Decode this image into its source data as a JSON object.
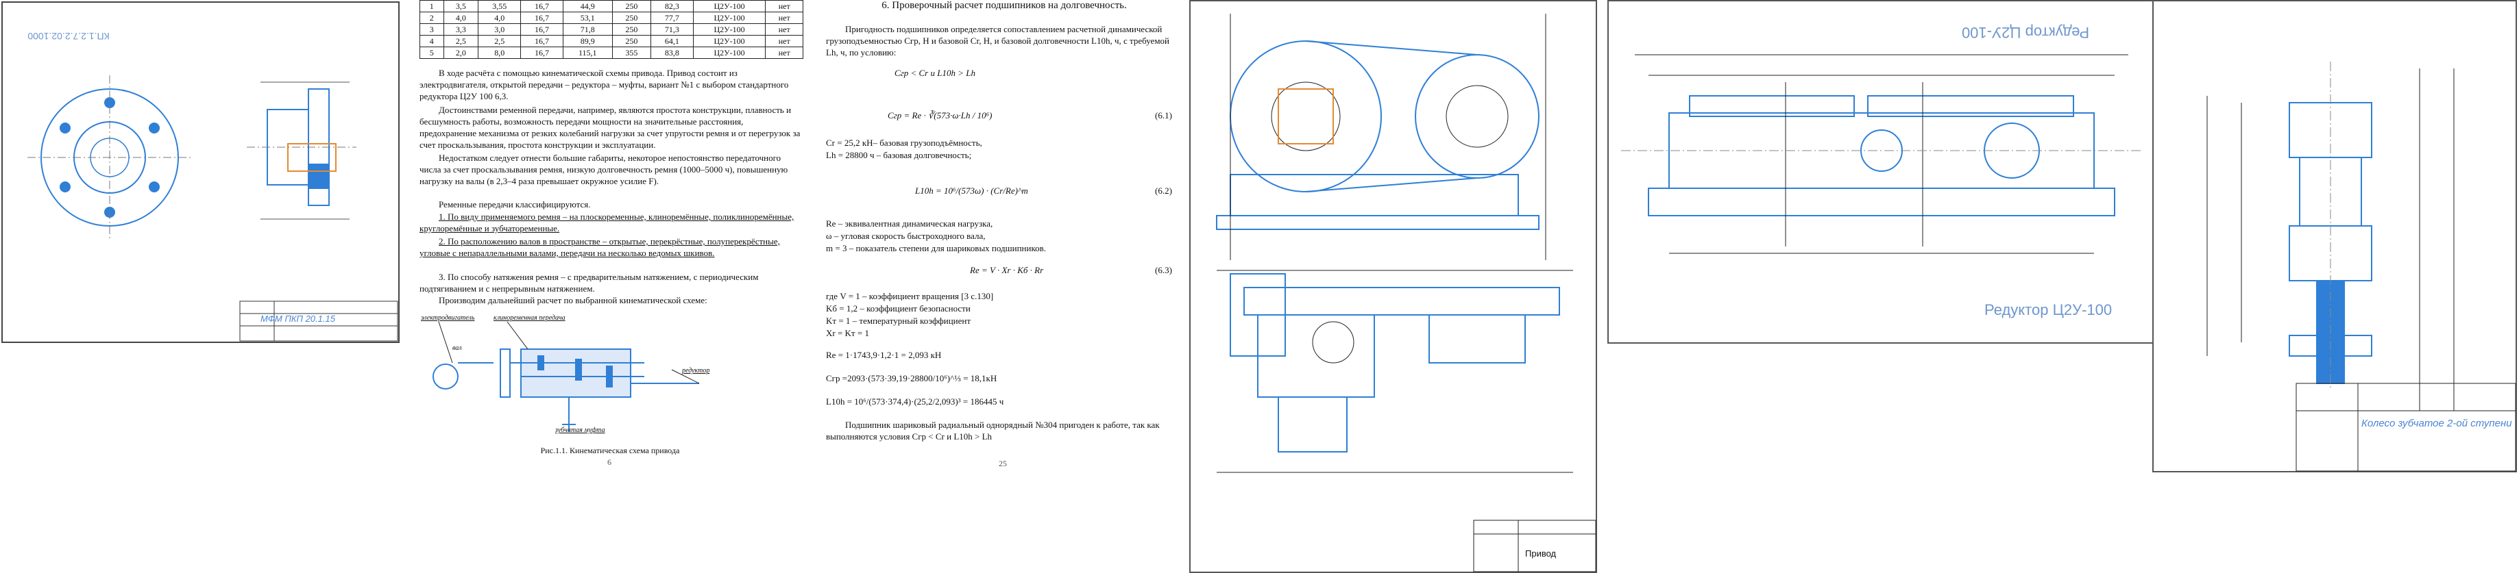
{
  "sheet1": {
    "corner_code": "КП.1.2.7.2.02.1000",
    "stamp": "МФМ ПКП 20.1.15"
  },
  "doc1": {
    "table": {
      "rows": [
        [
          "1",
          "3,5",
          "3,55",
          "16,7",
          "44,9",
          "250",
          "82,3",
          "Ц2У-100",
          "нет"
        ],
        [
          "2",
          "4,0",
          "4,0",
          "16,7",
          "53,1",
          "250",
          "77,7",
          "Ц2У-100",
          "нет"
        ],
        [
          "3",
          "3,3",
          "3,0",
          "16,7",
          "71,8",
          "250",
          "71,3",
          "Ц2У-100",
          "нет"
        ],
        [
          "4",
          "2,5",
          "2,5",
          "16,7",
          "89,9",
          "250",
          "64,1",
          "Ц2У-100",
          "нет"
        ],
        [
          "5",
          "2,0",
          "8,0",
          "16,7",
          "115,1",
          "355",
          "83,8",
          "Ц2У-100",
          "нет"
        ]
      ]
    },
    "paragraphs": [
      "В ходе расчёта с помощью кинематической схемы привода. Привод состоит из электродвигателя, открытой передачи – редуктора – муфты, вариант №1 с выбором стандартного редуктора Ц2У 100 6,3.",
      "Достоинствами ременной передачи, например, являются простота конструкции, плавность и бесшумность работы, возможность передачи мощности на значительные расстояния, предохранение механизма от резких колебаний нагрузки за счет упругости ремня и от перегрузок за счет проскальзывания, простота конструкции и эксплуатации.",
      "Недостатком следует отнести большие габариты, некоторое непостоянство передаточного числа за счет проскальзывания ремня, низкую долговечность ремня (1000–5000 ч), повышенную нагрузку на валы (в 2,3–4 раза превышает окружное усилие F).",
      "Ременные передачи классифицируются.",
      "1. По виду применяемого ремня – на плоскоременные, клиноремённые, поликлиноремённые, круглоремённые и зубчатоременные.",
      "2. По расположению валов в пространстве – открытые, перекрёстные, полуперекрёстные, угловые с непараллельными валами, передачи на несколько ведомых шкивов.",
      "3. По способу натяжения ремня – с предварительным натяжением, с периодическим подтягиванием и с непрерывным натяжением.",
      "Производим дальнейший расчет по выбранной кинематической схеме:"
    ],
    "scheme_labels": {
      "motor": "электродвигатель",
      "belt": "клиноременная передача",
      "reducer": "редуктор",
      "coupling": "зубчатая муфта",
      "shaft": "вал"
    },
    "caption": "Рис.1.1. Кинематическая схема привода",
    "page": "6"
  },
  "doc2": {
    "heading": "6. Проверочный расчет подшипников на долговечность.",
    "intro": "Пригодность подшипников определяется сопоставлением расчетной динамической грузоподъемностью Cгр, Н и базовой Cr, Н, и базовой долговечности L10h, ч, с требуемой Lh, ч, по условию:",
    "formula1": "Cгр < Cr и L10h > Lh",
    "formula2": "Cгр = Rе · ∛(573·ω·Lh / 10⁶)",
    "eq1": "(6.1)",
    "cr_text": "Cr = 25,2 кН– базовая грузоподъёмность,",
    "lh_text": "Lh = 28800 ч – базовая долговечность;",
    "formula3": "L10h = 10⁶/(573ω) · (Cr/Rе)^m",
    "eq2": "(6.2)",
    "re_text": "Rе – эквивалентная динамическая нагрузка,",
    "w_text": "ω – угловая скорость быстроходного вала,",
    "m_text": "m = 3 – показатель степени для шариковых подшипников.",
    "formula4": "Rе = V · Xr · Kб · Rr",
    "eq3": "(6.3)",
    "v_text": "где V = 1 – коэффициент вращения [3 с.130]",
    "kb_text": "Kб = 1,2 – коэффициент безопасности",
    "kt_text": "Kт = 1 – температурный коэффициент",
    "xr_text": "Xr = Kт = 1",
    "calc1": "Rе = 1·1743,9·1,2·1 = 2,093 кН",
    "calc2": "Cгр =2093·(573·39,19·28800/10⁶)^⅓ = 18,1кН",
    "calc3": "L10h = 10⁶/(573·374,4)·(25,2/2,093)³ = 186445 ч",
    "conclusion": "Подшипник шариковый радиальный однорядный №304 пригоден к работе, так как выполняются условия Cгр < Cr и L10h > Lh",
    "page": "25"
  },
  "drawing3": {
    "title": "Привод"
  },
  "drawing4": {
    "top_label": "Редуктор Ц2У-100",
    "stamp": "Редуктор Ц2У-100"
  },
  "drawing5": {
    "stamp": "Колесо зубчатое 2-ой ступени"
  }
}
